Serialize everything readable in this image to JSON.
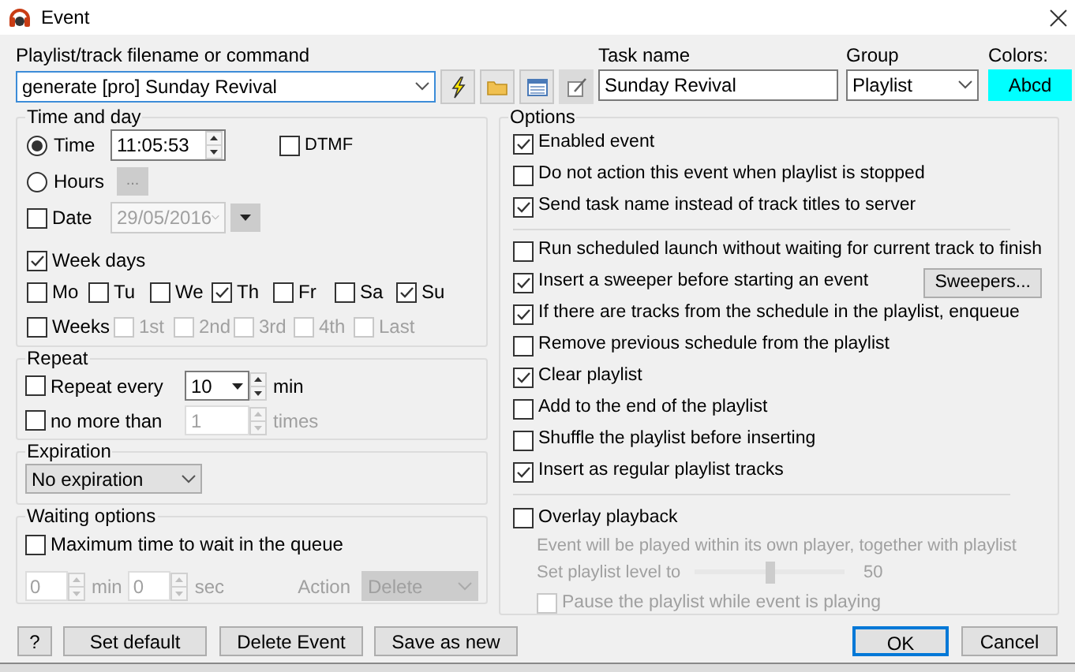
{
  "window": {
    "title": "Event"
  },
  "command": {
    "label": "Playlist/track filename or command",
    "value": "generate [pro] Sunday Revival"
  },
  "command_buttons": [
    {
      "kind": "lightning"
    },
    {
      "kind": "folder"
    },
    {
      "kind": "list"
    },
    {
      "kind": "edit"
    }
  ],
  "task_name": {
    "label": "Task name",
    "value": "Sunday Revival"
  },
  "group": {
    "label": "Group",
    "value": "Playlist"
  },
  "colors": {
    "label": "Colors:",
    "sample": "Abcd",
    "color": "#00ffff"
  },
  "time_and_day": {
    "title": "Time and day",
    "time": {
      "label": "Time",
      "selected": true,
      "value": "11:05:53"
    },
    "hours": {
      "label": "Hours",
      "selected": false,
      "button": "..."
    },
    "dtmf": {
      "label": "DTMF",
      "checked": false
    },
    "date": {
      "label": "Date",
      "checked": false,
      "value": "29/05/2016",
      "disabled": true
    },
    "week_days": {
      "label": "Week days",
      "checked": true,
      "days": [
        {
          "label": "Mo",
          "checked": false
        },
        {
          "label": "Tu",
          "checked": false
        },
        {
          "label": "We",
          "checked": false
        },
        {
          "label": "Th",
          "checked": true
        },
        {
          "label": "Fr",
          "checked": false
        },
        {
          "label": "Sa",
          "checked": false
        },
        {
          "label": "Su",
          "checked": true
        }
      ]
    },
    "weeks": {
      "label": "Weeks",
      "checked": false,
      "items": [
        {
          "label": "1st",
          "checked": false,
          "disabled": true
        },
        {
          "label": "2nd",
          "checked": false,
          "disabled": true
        },
        {
          "label": "3rd",
          "checked": false,
          "disabled": true
        },
        {
          "label": "4th",
          "checked": false,
          "disabled": true
        },
        {
          "label": "Last",
          "checked": false,
          "disabled": true
        }
      ]
    }
  },
  "repeat": {
    "title": "Repeat",
    "every": {
      "label": "Repeat every",
      "checked": false,
      "value": "10",
      "unit": "min",
      "disabled": false
    },
    "limit": {
      "label": "no more than",
      "checked": false,
      "value": "1",
      "unit": "times",
      "disabled": true
    }
  },
  "expiration": {
    "title": "Expiration",
    "value": "No expiration"
  },
  "waiting": {
    "title": "Waiting options",
    "max_wait": {
      "label": "Maximum time to wait in the queue",
      "checked": false
    },
    "min": {
      "value": "0",
      "unit": "min"
    },
    "sec": {
      "value": "0",
      "unit": "sec"
    },
    "action": {
      "label": "Action",
      "value": "Delete"
    },
    "disabled": true
  },
  "options": {
    "title": "Options",
    "groups": [
      [
        {
          "label": "Enabled event",
          "checked": true
        },
        {
          "label": "Do not action this event when playlist is stopped",
          "checked": false
        },
        {
          "label": "Send task name instead of track titles to server",
          "checked": true
        }
      ],
      [
        {
          "label": "Run scheduled launch without waiting for current track to finish",
          "checked": false
        },
        {
          "label": "Insert a sweeper before starting an event",
          "checked": true,
          "button": "Sweepers..."
        },
        {
          "label": "If there are tracks from the schedule in the playlist, enqueue",
          "checked": true
        },
        {
          "label": "Remove previous schedule from the playlist",
          "checked": false
        },
        {
          "label": "Clear playlist",
          "checked": true
        },
        {
          "label": "Add to the end of the playlist",
          "checked": false
        },
        {
          "label": "Shuffle the playlist before inserting",
          "checked": false
        },
        {
          "label": "Insert as regular playlist tracks",
          "checked": true
        }
      ]
    ],
    "overlay": {
      "label": "Overlay playback",
      "checked": false,
      "description": "Event will be played within its own player, together with playlist",
      "level_label": "Set playlist level to",
      "level": 0.5,
      "reading": "50",
      "pause": {
        "label": "Pause the playlist while event is playing",
        "checked": false
      },
      "disabled": true
    }
  },
  "buttons": [
    "?",
    "Set default",
    "Delete Event",
    "Save as new"
  ],
  "dialog_buttons": [
    {
      "label": "OK",
      "default": true
    },
    {
      "label": "Cancel",
      "default": false
    }
  ]
}
